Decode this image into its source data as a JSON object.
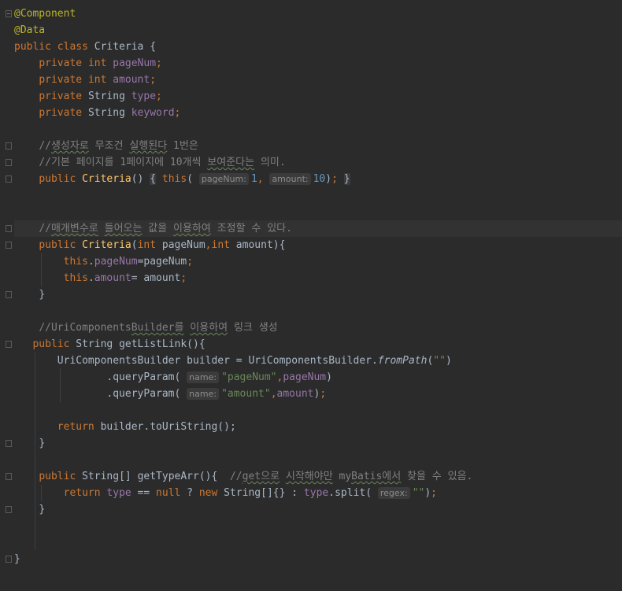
{
  "code": {
    "ann_component": "@Component",
    "ann_data": "@Data",
    "kw_public": "public",
    "kw_class": "class",
    "kw_private": "private",
    "kw_int": "int",
    "kw_this": "this",
    "kw_return": "return",
    "kw_null": "null",
    "kw_new": "new",
    "class_name": "Criteria",
    "type_string": "String",
    "type_string_arr": "String[]",
    "type_builder": "UriComponentsBuilder",
    "field_pageNum": "pageNum",
    "field_amount": "amount",
    "field_type": "type",
    "field_keyword": "keyword",
    "comment_1_prefix": "//",
    "comment_1_wavy": "생성자로",
    "comment_1_mid": " 무조건 ",
    "comment_1_wavy2": "실행된다",
    "comment_1_end": " 1번은",
    "comment_2_prefix": "//기본 페이지를 1페이지에 10개씩 ",
    "comment_2_wavy": "보여준다는",
    "comment_2_end": " 의미.",
    "hint_pageNum": "pageNum:",
    "hint_amount": "amount:",
    "hint_name": "name:",
    "hint_regex": "regex:",
    "num_1": "1",
    "num_10": "10",
    "comment_3_prefix": "//",
    "comment_3_wavy": "매개변수로",
    "comment_3_mid": " ",
    "comment_3_wavy2": "들어오는",
    "comment_3_mid2": " 값을 ",
    "comment_3_wavy3": "이용하여",
    "comment_3_end": " 조정할 수 있다.",
    "comment_4_prefix": "//UriComponents",
    "comment_4_wavy": "Builder를",
    "comment_4_mid": " ",
    "comment_4_wavy2": "이용하여",
    "comment_4_end": " 링크 생성",
    "method_getListLink": "getListLink",
    "var_builder": "builder",
    "method_fromPath": "fromPath",
    "method_queryParam": ".queryParam(",
    "method_toUriString": "builder.toUriString();",
    "str_empty": "\"\"",
    "str_pageNum": "\"pageNum\"",
    "str_amount": "\"amount\"",
    "method_getTypeArr": "getTypeArr",
    "comment_5_prefix": "//",
    "comment_5_wavy": "get으로",
    "comment_5_mid": " ",
    "comment_5_wavy2": "시작해야만",
    "comment_5_mid2": " my",
    "comment_5_wavy3": "Batis에서",
    "comment_5_end": " 찾을 수 있음.",
    "method_split": "split",
    "close_brace": "}"
  },
  "icons": {
    "bulb": "lightbulb-icon",
    "fold": "fold-marker-icon"
  },
  "colors": {
    "background": "#2b2b2b",
    "keyword": "#cc7832",
    "annotation": "#bbb529",
    "field": "#9876aa",
    "method": "#ffc66d",
    "comment": "#808080",
    "string": "#6a8759",
    "number": "#6897bb",
    "text": "#a9b7c6"
  }
}
